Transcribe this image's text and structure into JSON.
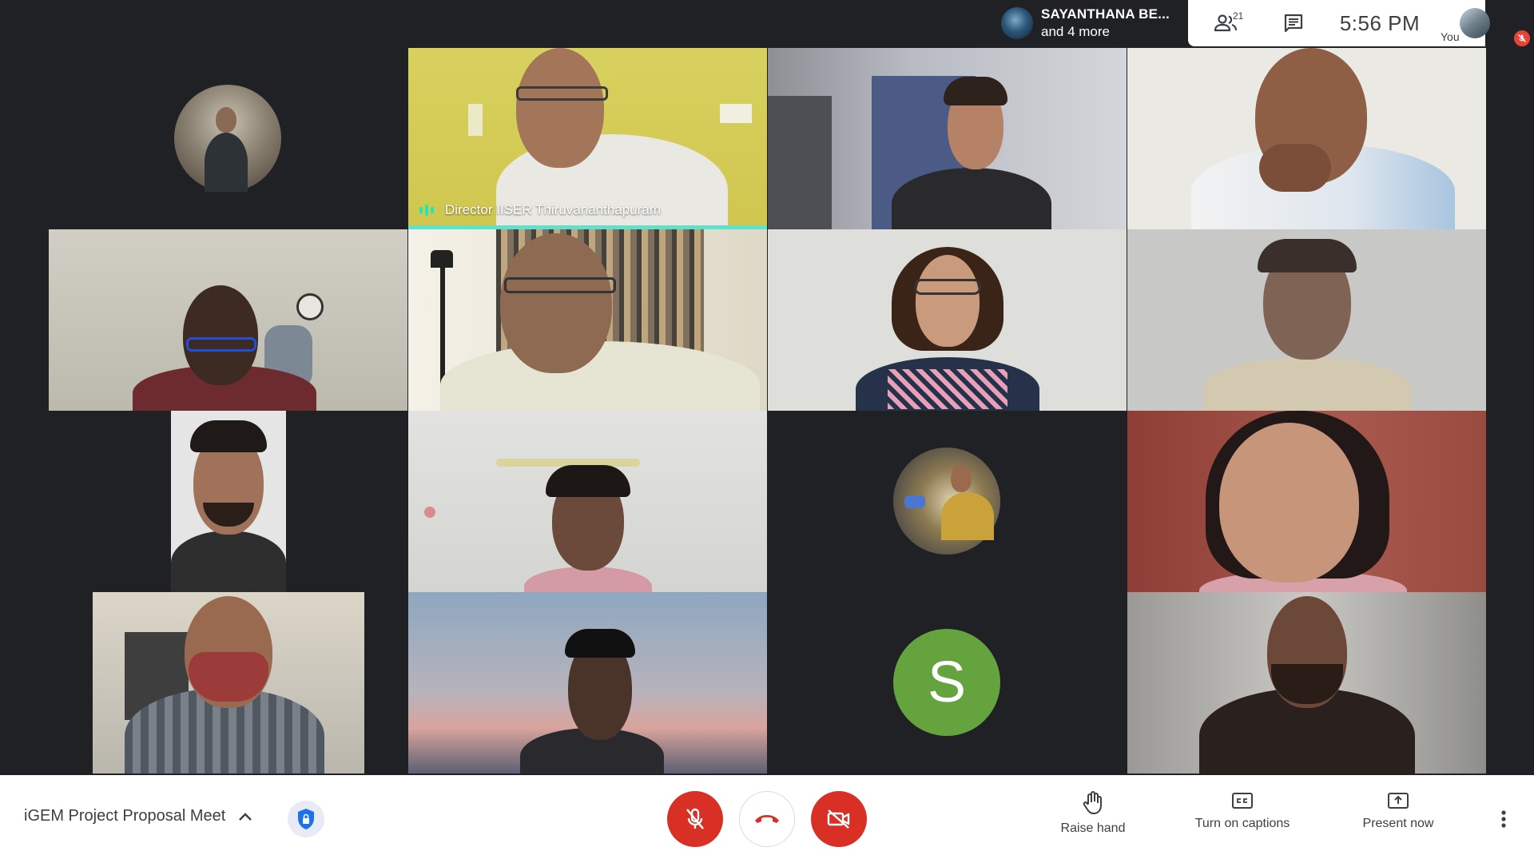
{
  "presenter": {
    "name": "SAYANTHANA BE...",
    "more": "and 4 more"
  },
  "top_panel": {
    "participant_count": "21",
    "time": "5:56  PM",
    "self_label": "You"
  },
  "tiles": [
    {
      "type": "avatar",
      "bg": "#202124"
    },
    {
      "type": "video",
      "name": "Director IISER Thiruvananthapuram",
      "speaking": true,
      "bg": "#d6cf55"
    },
    {
      "type": "video",
      "bg": "#b9bcc2"
    },
    {
      "type": "video",
      "bg": "#e8e6e2"
    },
    {
      "type": "video",
      "bg": "#c2bfb4"
    },
    {
      "type": "video",
      "bg": "#c7c4b9"
    },
    {
      "type": "video",
      "bg": "#dcdcd8"
    },
    {
      "type": "video",
      "bg": "#c9c9c9"
    },
    {
      "type": "video",
      "bg": "#202124"
    },
    {
      "type": "video",
      "bg": "#d8d8d5"
    },
    {
      "type": "avatar",
      "bg": "#202124"
    },
    {
      "type": "video",
      "bg": "#9e4e44"
    },
    {
      "type": "video",
      "bg": "#202124"
    },
    {
      "type": "video",
      "bg": "#a8b7c4"
    },
    {
      "type": "letter",
      "letter": "S",
      "color": "#65a33f"
    },
    {
      "type": "video",
      "bg": "#6a6a6a"
    }
  ],
  "bottom": {
    "meeting_title": "iGEM Project Proposal Meet",
    "raise_hand": "Raise hand",
    "captions": "Turn on captions",
    "present": "Present now"
  },
  "colors": {
    "end_call": "#d93025",
    "speaking": "#5fe1cc",
    "letter_avatar": "#65a33f"
  }
}
